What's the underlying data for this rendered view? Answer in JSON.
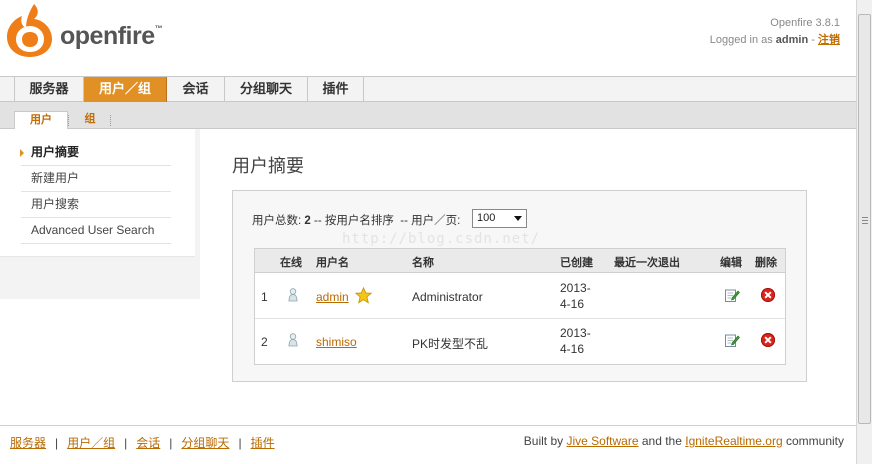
{
  "header": {
    "brand": "openfire",
    "version": "Openfire 3.8.1",
    "logged_in_prefix": "Logged in as",
    "username": "admin",
    "separator": "-",
    "logout_label": "注销"
  },
  "main_nav": {
    "tabs": [
      {
        "label": "服务器"
      },
      {
        "label": "用户／组"
      },
      {
        "label": "会话"
      },
      {
        "label": "分组聊天"
      },
      {
        "label": "插件"
      }
    ],
    "active_index": 1
  },
  "sub_nav": {
    "tabs": [
      {
        "label": "用户"
      },
      {
        "label": "组"
      }
    ],
    "active_index": 0
  },
  "sidebar": {
    "items": [
      {
        "label": "用户摘要"
      },
      {
        "label": "新建用户"
      },
      {
        "label": "用户搜索"
      },
      {
        "label": "Advanced User Search"
      }
    ],
    "active_index": 0
  },
  "main": {
    "title": "用户摘要",
    "summary_prefix": "用户总数:",
    "total_users": "2",
    "summary_sort": "-- 按用户名排序",
    "per_page_label": "-- 用户／页:",
    "per_page_value": "100",
    "watermark": "http://blog.csdn.net/",
    "table": {
      "columns": [
        "在线",
        "用户名",
        "名称",
        "已创建",
        "最近一次退出",
        "编辑",
        "删除"
      ],
      "rows": [
        {
          "index": "1",
          "username": "admin",
          "name": "Administrator",
          "created_line1": "2013-",
          "created_line2": "4-16",
          "last_logout": "",
          "is_admin": true
        },
        {
          "index": "2",
          "username": "shimiso",
          "name": "PK时发型不乱",
          "created_line1": "2013-",
          "created_line2": "4-16",
          "last_logout": "",
          "is_admin": false
        }
      ]
    }
  },
  "footer": {
    "links": [
      "服务器",
      "用户／组",
      "会话",
      "分组聊天",
      "插件"
    ],
    "link_separator": "|",
    "credits_prefix": "Built by",
    "credits_link1": "Jive Software",
    "credits_middle": "and the",
    "credits_link2": "IgniteRealtime.org",
    "credits_suffix": "community"
  },
  "colors": {
    "accent": "#e09025",
    "link": "#b96a00",
    "delete": "#d9261c"
  },
  "icons": {
    "logo": "openfire-flame-logo",
    "online": "user-offline-icon",
    "admin": "star-icon",
    "edit": "edit-icon",
    "delete": "delete-icon"
  }
}
